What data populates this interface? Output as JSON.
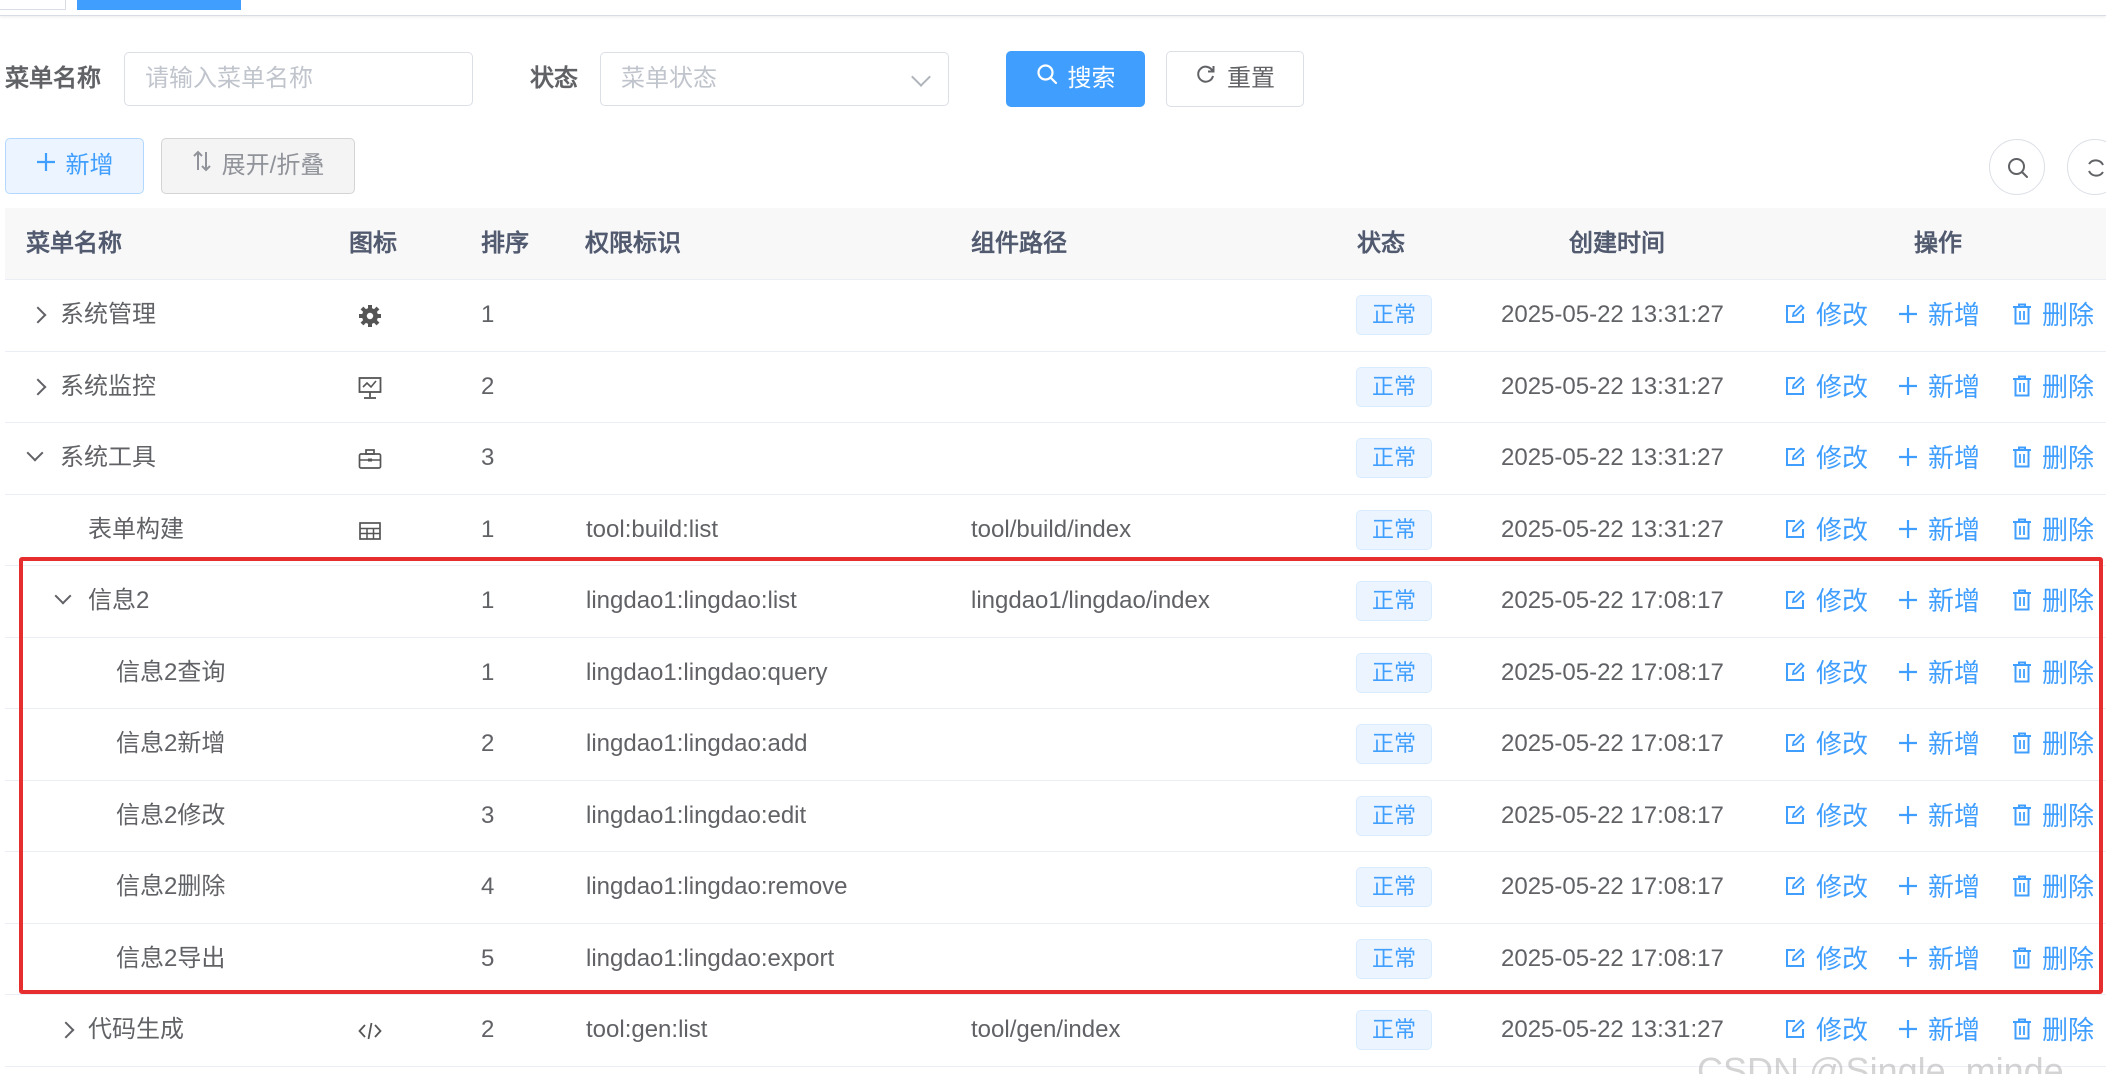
{
  "search": {
    "menu_name_label": "菜单名称",
    "menu_name_placeholder": "请输入菜单名称",
    "status_label": "状态",
    "status_placeholder": "菜单状态",
    "search_button": "搜索",
    "reset_button": "重置"
  },
  "toolbar": {
    "add_button": "新增",
    "toggle_button": "展开/折叠"
  },
  "table": {
    "headers": {
      "name": "菜单名称",
      "icon": "图标",
      "order": "排序",
      "perms": "权限标识",
      "component": "组件路径",
      "status": "状态",
      "created": "创建时间",
      "actions": "操作"
    },
    "actions": {
      "edit": "修改",
      "add": "新增",
      "delete": "删除"
    },
    "rows": [
      {
        "name": "系统管理",
        "icon": "gear-icon",
        "order": "1",
        "perms": "",
        "component": "",
        "status": "正常",
        "created": "2025-05-22 13:31:27"
      },
      {
        "name": "系统监控",
        "icon": "monitor-icon",
        "order": "2",
        "perms": "",
        "component": "",
        "status": "正常",
        "created": "2025-05-22 13:31:27"
      },
      {
        "name": "系统工具",
        "icon": "toolbox-icon",
        "order": "3",
        "perms": "",
        "component": "",
        "status": "正常",
        "created": "2025-05-22 13:31:27"
      },
      {
        "name": "表单构建",
        "icon": "table-icon",
        "order": "1",
        "perms": "tool:build:list",
        "component": "tool/build/index",
        "status": "正常",
        "created": "2025-05-22 13:31:27"
      },
      {
        "name": "信息2",
        "icon": "",
        "order": "1",
        "perms": "lingdao1:lingdao:list",
        "component": "lingdao1/lingdao/index",
        "status": "正常",
        "created": "2025-05-22 17:08:17"
      },
      {
        "name": "信息2查询",
        "icon": "",
        "order": "1",
        "perms": "lingdao1:lingdao:query",
        "component": "",
        "status": "正常",
        "created": "2025-05-22 17:08:17"
      },
      {
        "name": "信息2新增",
        "icon": "",
        "order": "2",
        "perms": "lingdao1:lingdao:add",
        "component": "",
        "status": "正常",
        "created": "2025-05-22 17:08:17"
      },
      {
        "name": "信息2修改",
        "icon": "",
        "order": "3",
        "perms": "lingdao1:lingdao:edit",
        "component": "",
        "status": "正常",
        "created": "2025-05-22 17:08:17"
      },
      {
        "name": "信息2删除",
        "icon": "",
        "order": "4",
        "perms": "lingdao1:lingdao:remove",
        "component": "",
        "status": "正常",
        "created": "2025-05-22 17:08:17"
      },
      {
        "name": "信息2导出",
        "icon": "",
        "order": "5",
        "perms": "lingdao1:lingdao:export",
        "component": "",
        "status": "正常",
        "created": "2025-05-22 17:08:17"
      },
      {
        "name": "代码生成",
        "icon": "code-icon",
        "order": "2",
        "perms": "tool:gen:list",
        "component": "tool/gen/index",
        "status": "正常",
        "created": "2025-05-22 13:31:27"
      }
    ]
  },
  "watermark": "CSDN @Single_minde",
  "colors": {
    "primary": "#409eff",
    "highlight": "#e62e2e"
  }
}
